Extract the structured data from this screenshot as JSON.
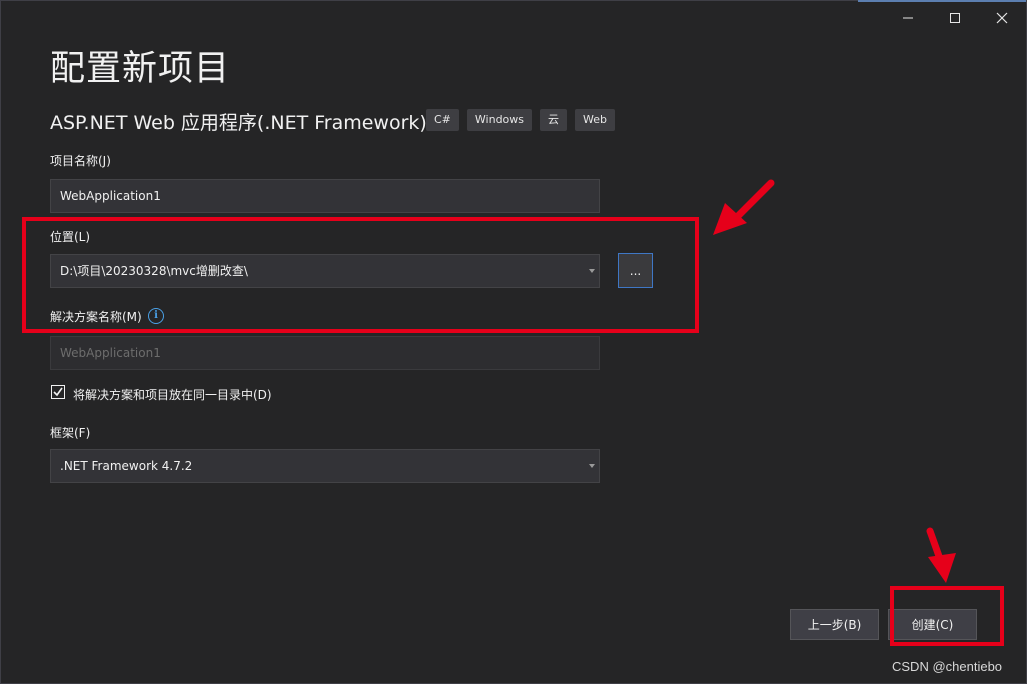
{
  "window": {
    "controls": [
      "minimize-icon",
      "maximize-icon",
      "close-icon"
    ]
  },
  "page": {
    "title": "配置新项目",
    "subtitle": "ASP.NET Web 应用程序(.NET Framework)",
    "tags": [
      "C#",
      "Windows",
      "云",
      "Web"
    ]
  },
  "form": {
    "project_name_label": "项目名称(J)",
    "project_name_value": "WebApplication1",
    "location_label": "位置(L)",
    "location_value": "D:\\项目\\20230328\\mvc增删改查\\",
    "browse_label": "...",
    "solution_name_label": "解决方案名称(M)",
    "solution_name_value": "WebApplication1",
    "same_dir_label": "将解决方案和项目放在同一目录中(D)",
    "same_dir_checked": true,
    "framework_label": "框架(F)",
    "framework_value": ".NET Framework 4.7.2"
  },
  "footer": {
    "back_label": "上一步(B)",
    "create_label": "创建(C)"
  },
  "watermark": "CSDN @chentiebo",
  "colors": {
    "background": "#252526",
    "field": "#333337",
    "accent": "#3f77c5",
    "annotation_red": "#e6001a"
  }
}
